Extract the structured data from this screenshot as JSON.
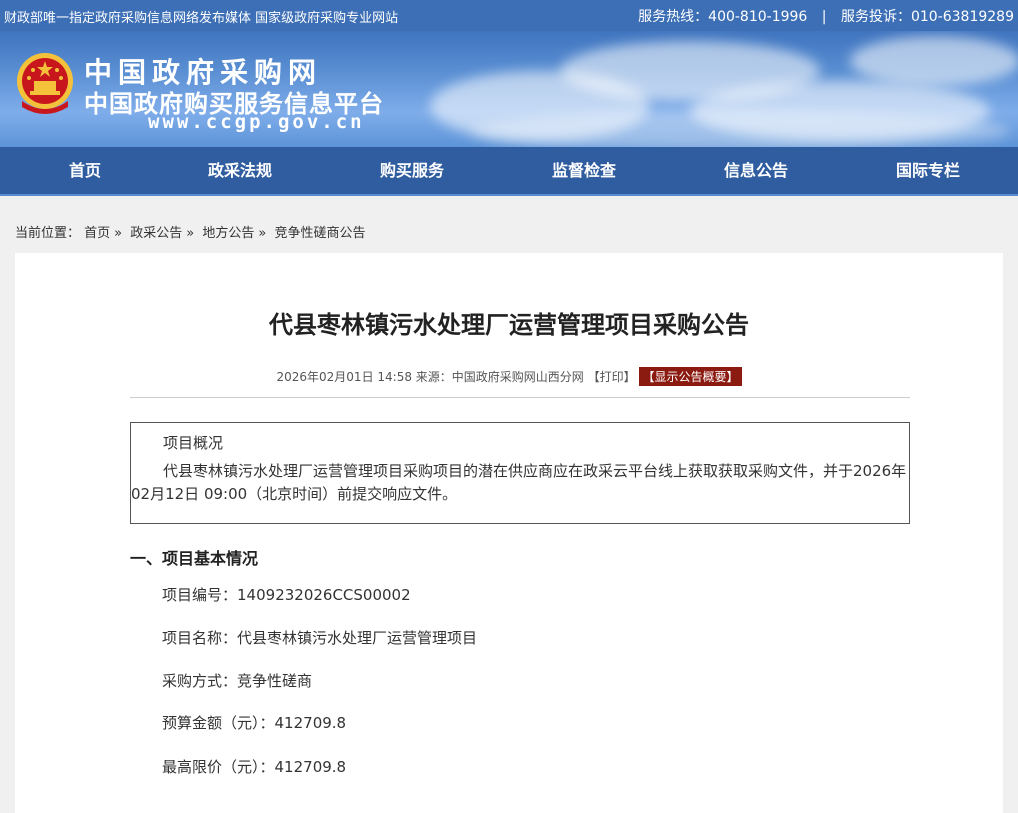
{
  "topbar": {
    "slogan": "财政部唯一指定政府采购信息网络发布媒体 国家级政府采购专业网站",
    "hotline": "服务热线：400-810-1996",
    "separator": "|",
    "complaint": "服务投诉：010-63819289"
  },
  "banner": {
    "line1": "中国政府采购网",
    "line2": "中国政府购买服务信息平台",
    "url": "www.ccgp.gov.cn",
    "emblem_icon": "national-emblem"
  },
  "nav": {
    "items": [
      "首页",
      "政采法规",
      "购买服务",
      "监督检查",
      "信息公告",
      "国际专栏"
    ]
  },
  "breadcrumb": {
    "prefix": "当前位置：",
    "items": [
      "首页",
      "政采公告",
      "地方公告",
      "竞争性磋商公告"
    ],
    "arrow": "»"
  },
  "article": {
    "title": "代县枣林镇污水处理厂运营管理项目采购公告",
    "meta_date": "2026年02月01日 14:58",
    "meta_source": "来源：中国政府采购网山西分网",
    "print_label": "【打印】",
    "summary_label": "【显示公告概要】",
    "overview_heading": "项目概况",
    "overview_text": "代县枣林镇污水处理厂运营管理项目采购项目的潜在供应商应在政采云平台线上获取获取采购文件，并于2026年02月12日 09:00（北京时间）前提交响应文件。",
    "section1_heading": "一、项目基本情况",
    "fields": [
      {
        "label": "项目编号：",
        "value": "1409232026CCS00002"
      },
      {
        "label": "项目名称：",
        "value": "代县枣林镇污水处理厂运营管理项目"
      },
      {
        "label": "采购方式：",
        "value": "竞争性磋商"
      },
      {
        "label": "预算金额（元）：",
        "value": "412709.8"
      },
      {
        "label": "最高限价（元）：",
        "value": "412709.8"
      }
    ]
  },
  "colors": {
    "topbar": "#3c6fb6",
    "nav": "#2f5d9f",
    "summary_badge": "#8b1a10"
  }
}
